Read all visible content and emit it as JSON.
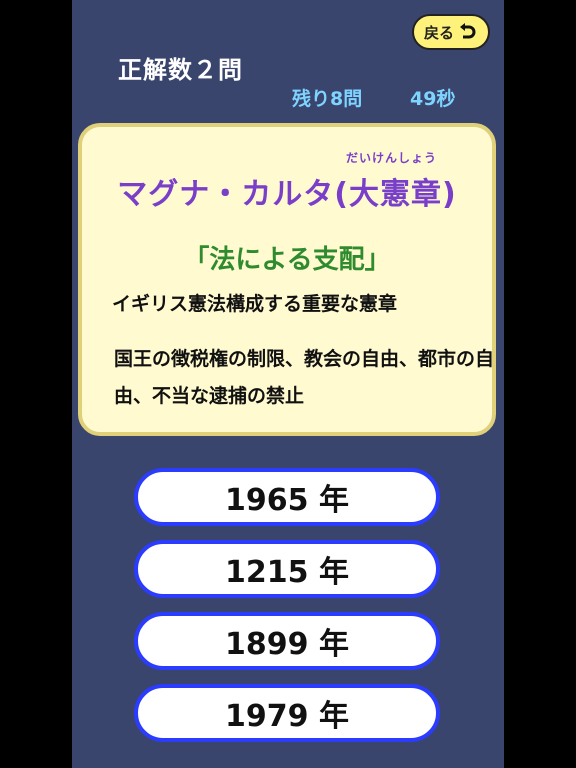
{
  "header": {
    "score": "正解数２問",
    "remaining": "残り8問",
    "timer": "49秒",
    "back_label": "戻る"
  },
  "question": {
    "ruby": "だいけんしょう",
    "term": "マグナ・カルタ(大憲章)",
    "keyword": "「法による支配」",
    "description_1": "イギリス憲法構成する重要な憲章",
    "description_2": "国王の徴税権の制限、教会の自由、都市の自由、不当な逮捕の禁止"
  },
  "answers": [
    {
      "label": "1965 年"
    },
    {
      "label": "1215 年"
    },
    {
      "label": "1899 年"
    },
    {
      "label": "1979 年"
    }
  ],
  "colors": {
    "background": "#39456d",
    "card": "#fffad0",
    "term": "#7a3fc9",
    "keyword": "#2e8b2e",
    "info": "#7fd3ff",
    "answer_border": "#2b3cff",
    "back_button": "#fff27a"
  },
  "icons": {
    "back": "return-arrow-icon"
  }
}
